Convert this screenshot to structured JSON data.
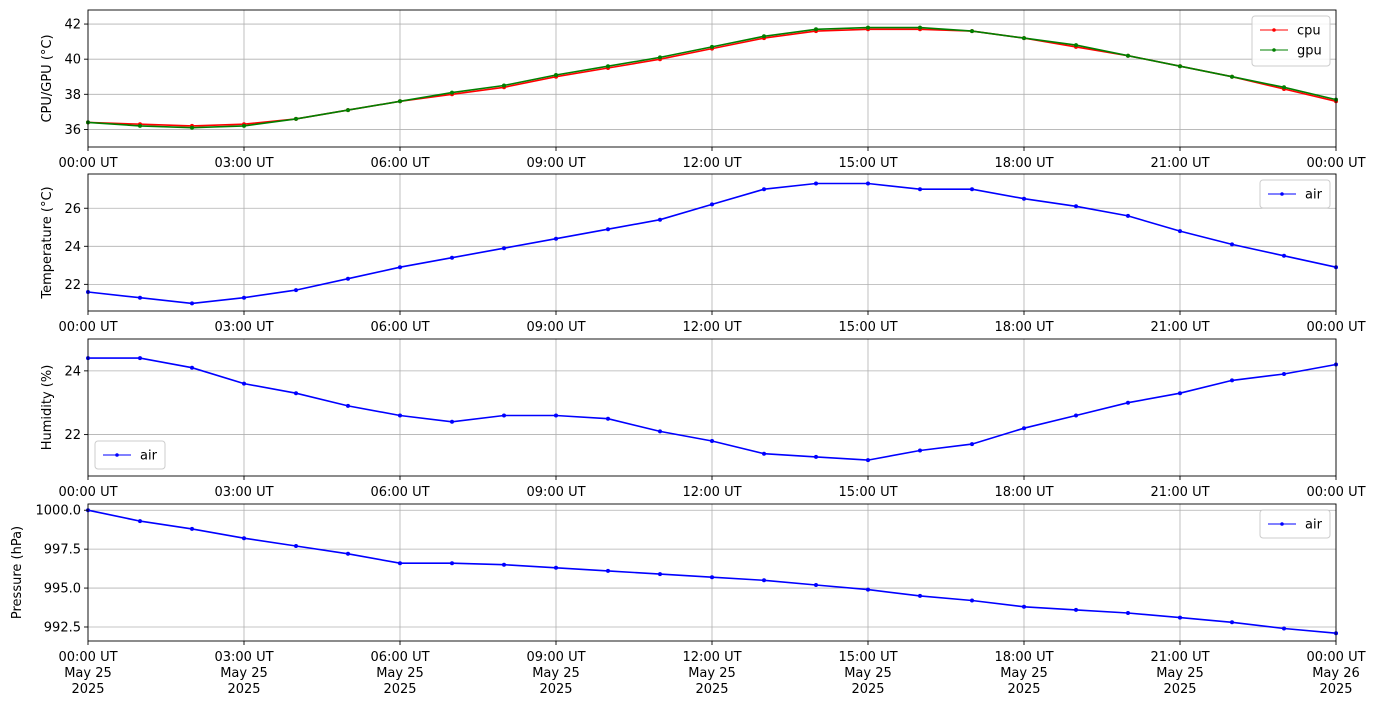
{
  "chart_data": [
    {
      "type": "line",
      "ylabel": "CPU/GPU (°C)",
      "ylim": [
        35.0,
        42.8
      ],
      "yticks": [
        36,
        38,
        40,
        42
      ],
      "ytick_labels": [
        "36",
        "38",
        "40",
        "42"
      ],
      "xticks": [
        0,
        3,
        6,
        9,
        12,
        15,
        18,
        21,
        24
      ],
      "xtick_labels": [
        "00:00 UT",
        "03:00 UT",
        "06:00 UT",
        "09:00 UT",
        "12:00 UT",
        "15:00 UT",
        "18:00 UT",
        "21:00 UT",
        "00:00 UT"
      ],
      "xlim": [
        0,
        24
      ],
      "grid": true,
      "legend_position": "top-right",
      "series": [
        {
          "name": "cpu",
          "color": "#ff0000",
          "x": [
            0,
            1,
            2,
            3,
            4,
            5,
            6,
            7,
            8,
            9,
            10,
            11,
            12,
            13,
            14,
            15,
            16,
            17,
            18,
            19,
            20,
            21,
            22,
            23,
            24
          ],
          "values": [
            36.4,
            36.3,
            36.2,
            36.3,
            36.6,
            37.1,
            37.6,
            38.0,
            38.4,
            39.0,
            39.5,
            40.0,
            40.6,
            41.2,
            41.6,
            41.7,
            41.7,
            41.6,
            41.2,
            40.7,
            40.2,
            39.6,
            39.0,
            38.3,
            37.6
          ]
        },
        {
          "name": "gpu",
          "color": "#008000",
          "x": [
            0,
            1,
            2,
            3,
            4,
            5,
            6,
            7,
            8,
            9,
            10,
            11,
            12,
            13,
            14,
            15,
            16,
            17,
            18,
            19,
            20,
            21,
            22,
            23,
            24
          ],
          "values": [
            36.4,
            36.2,
            36.1,
            36.2,
            36.6,
            37.1,
            37.6,
            38.1,
            38.5,
            39.1,
            39.6,
            40.1,
            40.7,
            41.3,
            41.7,
            41.8,
            41.8,
            41.6,
            41.2,
            40.8,
            40.2,
            39.6,
            39.0,
            38.4,
            37.7
          ]
        }
      ]
    },
    {
      "type": "line",
      "ylabel": "Temperature (°C)",
      "ylim": [
        20.6,
        27.8
      ],
      "yticks": [
        22,
        24,
        26
      ],
      "ytick_labels": [
        "22",
        "24",
        "26"
      ],
      "xticks": [
        0,
        3,
        6,
        9,
        12,
        15,
        18,
        21,
        24
      ],
      "xtick_labels": [
        "00:00 UT",
        "03:00 UT",
        "06:00 UT",
        "09:00 UT",
        "12:00 UT",
        "15:00 UT",
        "18:00 UT",
        "21:00 UT",
        "00:00 UT"
      ],
      "xlim": [
        0,
        24
      ],
      "grid": true,
      "legend_position": "top-right",
      "series": [
        {
          "name": "air",
          "color": "#0000ff",
          "x": [
            0,
            1,
            2,
            3,
            4,
            5,
            6,
            7,
            8,
            9,
            10,
            11,
            12,
            13,
            14,
            15,
            16,
            17,
            18,
            19,
            20,
            21,
            22,
            23,
            24
          ],
          "values": [
            21.6,
            21.3,
            21.0,
            21.3,
            21.7,
            22.3,
            22.9,
            23.4,
            23.9,
            24.4,
            24.9,
            25.4,
            26.2,
            27.0,
            27.3,
            27.3,
            27.0,
            27.0,
            26.5,
            26.1,
            25.6,
            24.8,
            24.1,
            23.5,
            22.9
          ]
        }
      ]
    },
    {
      "type": "line",
      "ylabel": "Humidity (%)",
      "ylim": [
        20.7,
        25.0
      ],
      "yticks": [
        22,
        24
      ],
      "ytick_labels": [
        "22",
        "24"
      ],
      "xticks": [
        0,
        3,
        6,
        9,
        12,
        15,
        18,
        21,
        24
      ],
      "xtick_labels": [
        "00:00 UT",
        "03:00 UT",
        "06:00 UT",
        "09:00 UT",
        "12:00 UT",
        "15:00 UT",
        "18:00 UT",
        "21:00 UT",
        "00:00 UT"
      ],
      "xlim": [
        0,
        24
      ],
      "grid": true,
      "legend_position": "bottom-left",
      "series": [
        {
          "name": "air",
          "color": "#0000ff",
          "x": [
            0,
            1,
            2,
            3,
            4,
            5,
            6,
            7,
            8,
            9,
            10,
            11,
            12,
            13,
            14,
            15,
            16,
            17,
            18,
            19,
            20,
            21,
            22,
            23,
            24
          ],
          "values": [
            24.4,
            24.4,
            24.1,
            23.6,
            23.3,
            22.9,
            22.6,
            22.4,
            22.6,
            22.6,
            22.5,
            22.1,
            21.8,
            21.4,
            21.3,
            21.2,
            21.5,
            21.7,
            22.2,
            22.6,
            23.0,
            23.3,
            23.7,
            23.9,
            24.2
          ]
        }
      ]
    },
    {
      "type": "line",
      "ylabel": "Pressure (hPa)",
      "ylim": [
        991.6,
        1000.4
      ],
      "yticks": [
        992.5,
        995.0,
        997.5,
        1000.0
      ],
      "ytick_labels": [
        "992.5",
        "995.0",
        "997.5",
        "1000.0"
      ],
      "xticks": [
        0,
        3,
        6,
        9,
        12,
        15,
        18,
        21,
        24
      ],
      "xtick_labels": [
        "00:00 UT\nMay 25\n2025",
        "03:00 UT\nMay 25\n2025",
        "06:00 UT\nMay 25\n2025",
        "09:00 UT\nMay 25\n2025",
        "12:00 UT\nMay 25\n2025",
        "15:00 UT\nMay 25\n2025",
        "18:00 UT\nMay 25\n2025",
        "21:00 UT\nMay 25\n2025",
        "00:00 UT\nMay 26\n2025"
      ],
      "xlim": [
        0,
        24
      ],
      "grid": true,
      "legend_position": "top-right",
      "series": [
        {
          "name": "air",
          "color": "#0000ff",
          "x": [
            0,
            1,
            2,
            3,
            4,
            5,
            6,
            7,
            8,
            9,
            10,
            11,
            12,
            13,
            14,
            15,
            16,
            17,
            18,
            19,
            20,
            21,
            22,
            23,
            24
          ],
          "values": [
            1000.0,
            999.3,
            998.8,
            998.2,
            997.7,
            997.2,
            996.6,
            996.6,
            996.5,
            996.3,
            996.1,
            995.9,
            995.7,
            995.5,
            995.2,
            994.9,
            994.5,
            994.2,
            993.8,
            993.6,
            993.4,
            993.1,
            992.8,
            992.4,
            992.1
          ]
        }
      ]
    }
  ]
}
